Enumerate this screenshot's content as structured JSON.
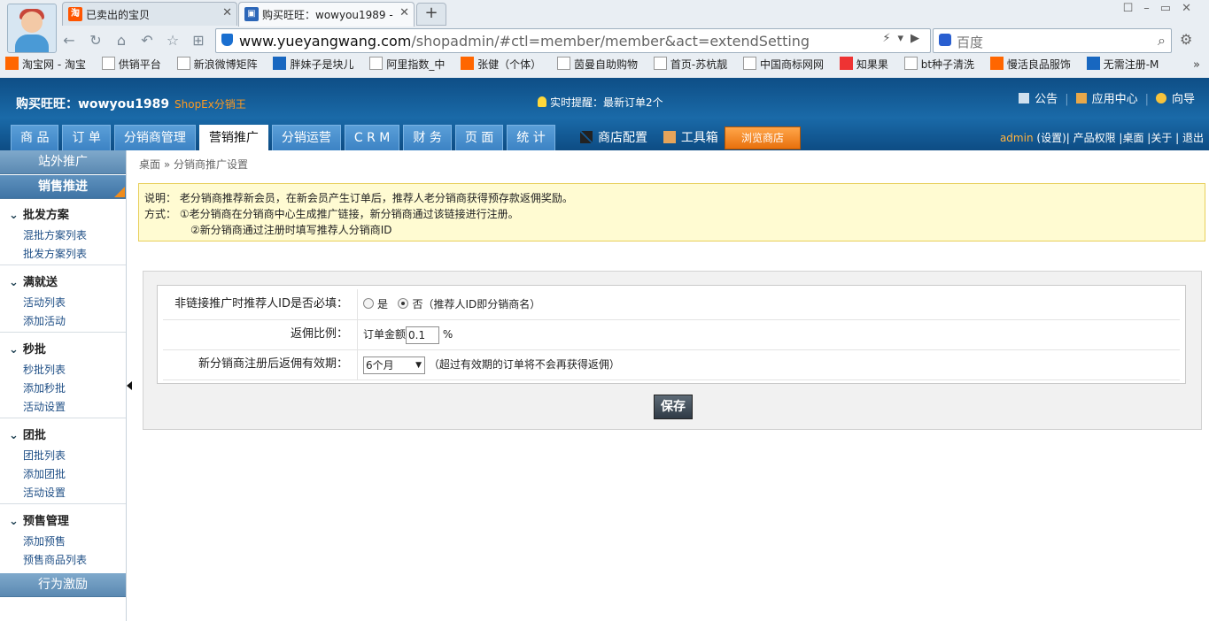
{
  "browser": {
    "tabs": [
      {
        "title": "已卖出的宝贝",
        "icon": "taobao-icon"
      },
      {
        "title": "购买旺旺：wowyou1989 -",
        "icon": "shop-icon"
      }
    ],
    "url_host": "www.yueyangwang.com",
    "url_path": "/shopadmin/#ctl=member/member&act=extendSetting",
    "search_placeholder": "百度",
    "bookmarks": [
      "淘宝网 - 淘宝",
      "供销平台",
      "新浪微博矩阵",
      "胖妹子是块儿",
      "阿里指数_中",
      "张健（个体）",
      "茵曼自助购物",
      "首页-苏杭靓",
      "中国商标网网",
      "知果果",
      "bt种子清洗",
      "慢活良品服饰",
      "无需注册-M"
    ],
    "bookmarks_more": "»"
  },
  "header": {
    "brand": "购买旺旺：wowyou1989",
    "brand_sub": "ShopEx分销王",
    "notice": "实时提醒：最新订单2个",
    "top_links": [
      "公告",
      "应用中心",
      "向导"
    ],
    "nav": [
      "商 品",
      "订 单",
      "分销商管理",
      "营销推广",
      "分销运营",
      "C R M",
      "财 务",
      "页 面",
      "统 计"
    ],
    "nav_active": "营销推广",
    "extra_links": [
      "商店配置",
      "工具箱"
    ],
    "browse_button": "浏览商店",
    "user": "admin",
    "user_links": "(设置)| 产品权限 |桌面 |关于 | 退出"
  },
  "sidebar": {
    "top_item": "站外推广",
    "section": "销售推进",
    "groups": [
      {
        "title": "批发方案",
        "items": [
          "混批方案列表",
          "批发方案列表"
        ]
      },
      {
        "title": "满就送",
        "items": [
          "活动列表",
          "添加活动"
        ]
      },
      {
        "title": "秒批",
        "items": [
          "秒批列表",
          "添加秒批",
          "活动设置"
        ]
      },
      {
        "title": "团批",
        "items": [
          "团批列表",
          "添加团批",
          "活动设置"
        ]
      },
      {
        "title": "预售管理",
        "items": [
          "添加预售",
          "预售商品列表"
        ]
      }
    ],
    "bottom_item": "行为激励"
  },
  "breadcrumb": "桌面 » 分销商推广设置",
  "note": {
    "line1": "说明：  老分销商推荐新会员，在新会员产生订单后，推荐人老分销商获得预存款返佣奖励。",
    "line2": "方式：  ①老分销商在分销商中心生成推广链接，新分销商通过该链接进行注册。",
    "line3": "②新分销商通过注册时填写推荐人分销商ID"
  },
  "form": {
    "row1_label": "非链接推广时推荐人ID是否必填：",
    "row1_opt_yes": "是",
    "row1_opt_no": "否（推荐人ID即分销商名）",
    "row1_selected": "否",
    "row2_label": "返佣比例：",
    "row2_prefix": "订单金额",
    "row2_value": "0.1",
    "row2_suffix": "%",
    "row3_label": "新分销商注册后返佣有效期：",
    "row3_value": "6个月",
    "row3_hint": "（超过有效期的订单将不会再获得返佣）",
    "save": "保存"
  }
}
